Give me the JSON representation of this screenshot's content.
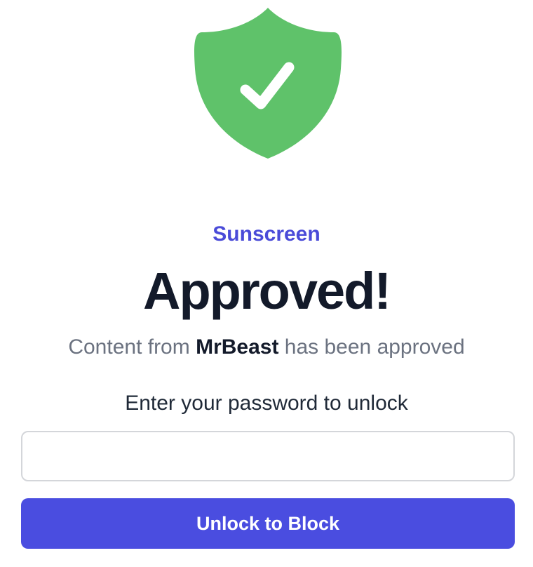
{
  "header": {
    "icon": "shield-check-icon",
    "brand": "Sunscreen"
  },
  "status": {
    "title": "Approved!",
    "message_prefix": "Content from ",
    "creator": "MrBeast",
    "message_suffix": " has been approved"
  },
  "unlock_form": {
    "prompt": "Enter your password to unlock",
    "password_value": "",
    "password_placeholder": "",
    "button_label": "Unlock to Block"
  },
  "colors": {
    "shield": "#5fc26a",
    "brand": "#4a4bd8",
    "button": "#4a4de0"
  }
}
